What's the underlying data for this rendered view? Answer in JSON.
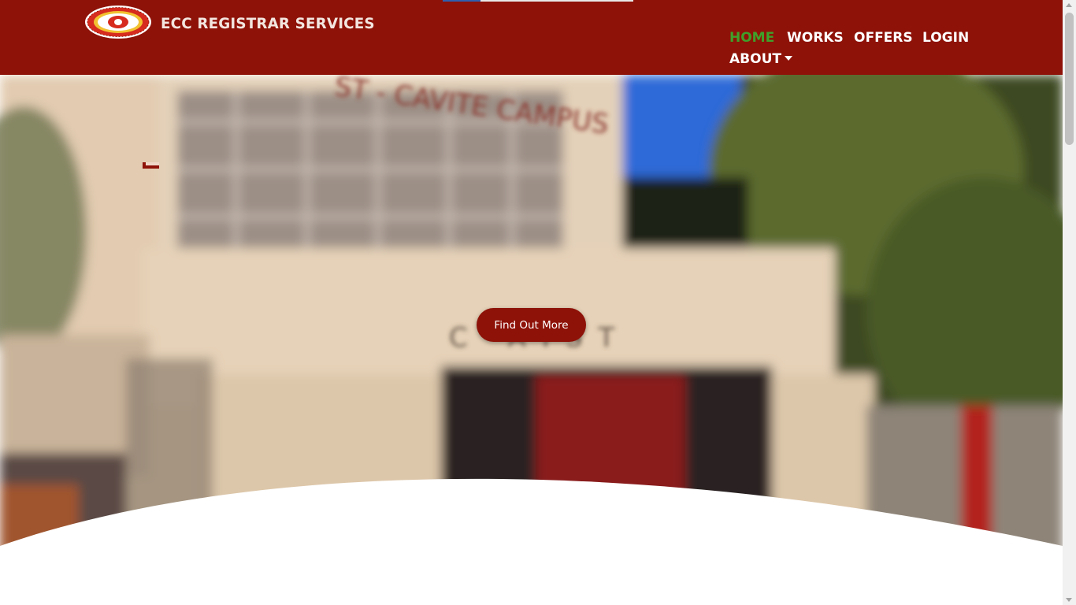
{
  "brand": {
    "name": "ECC REGISTRAR SERVICES",
    "logo_icon": "ecc-seal-logo"
  },
  "nav": {
    "items": [
      {
        "label": "HOME",
        "active": true
      },
      {
        "label": "WORKS",
        "active": false
      },
      {
        "label": "OFFERS",
        "active": false
      },
      {
        "label": "LOGIN",
        "active": false
      },
      {
        "label": "ABOUT",
        "active": false,
        "dropdown_icon": "caret-down-icon"
      }
    ]
  },
  "hero": {
    "background": "blurred-campus-building-photo",
    "cta_label": "Find Out More"
  },
  "colors": {
    "brand_red": "#8e1208",
    "nav_active": "#3fa02a",
    "nav_text": "#ffffff"
  }
}
